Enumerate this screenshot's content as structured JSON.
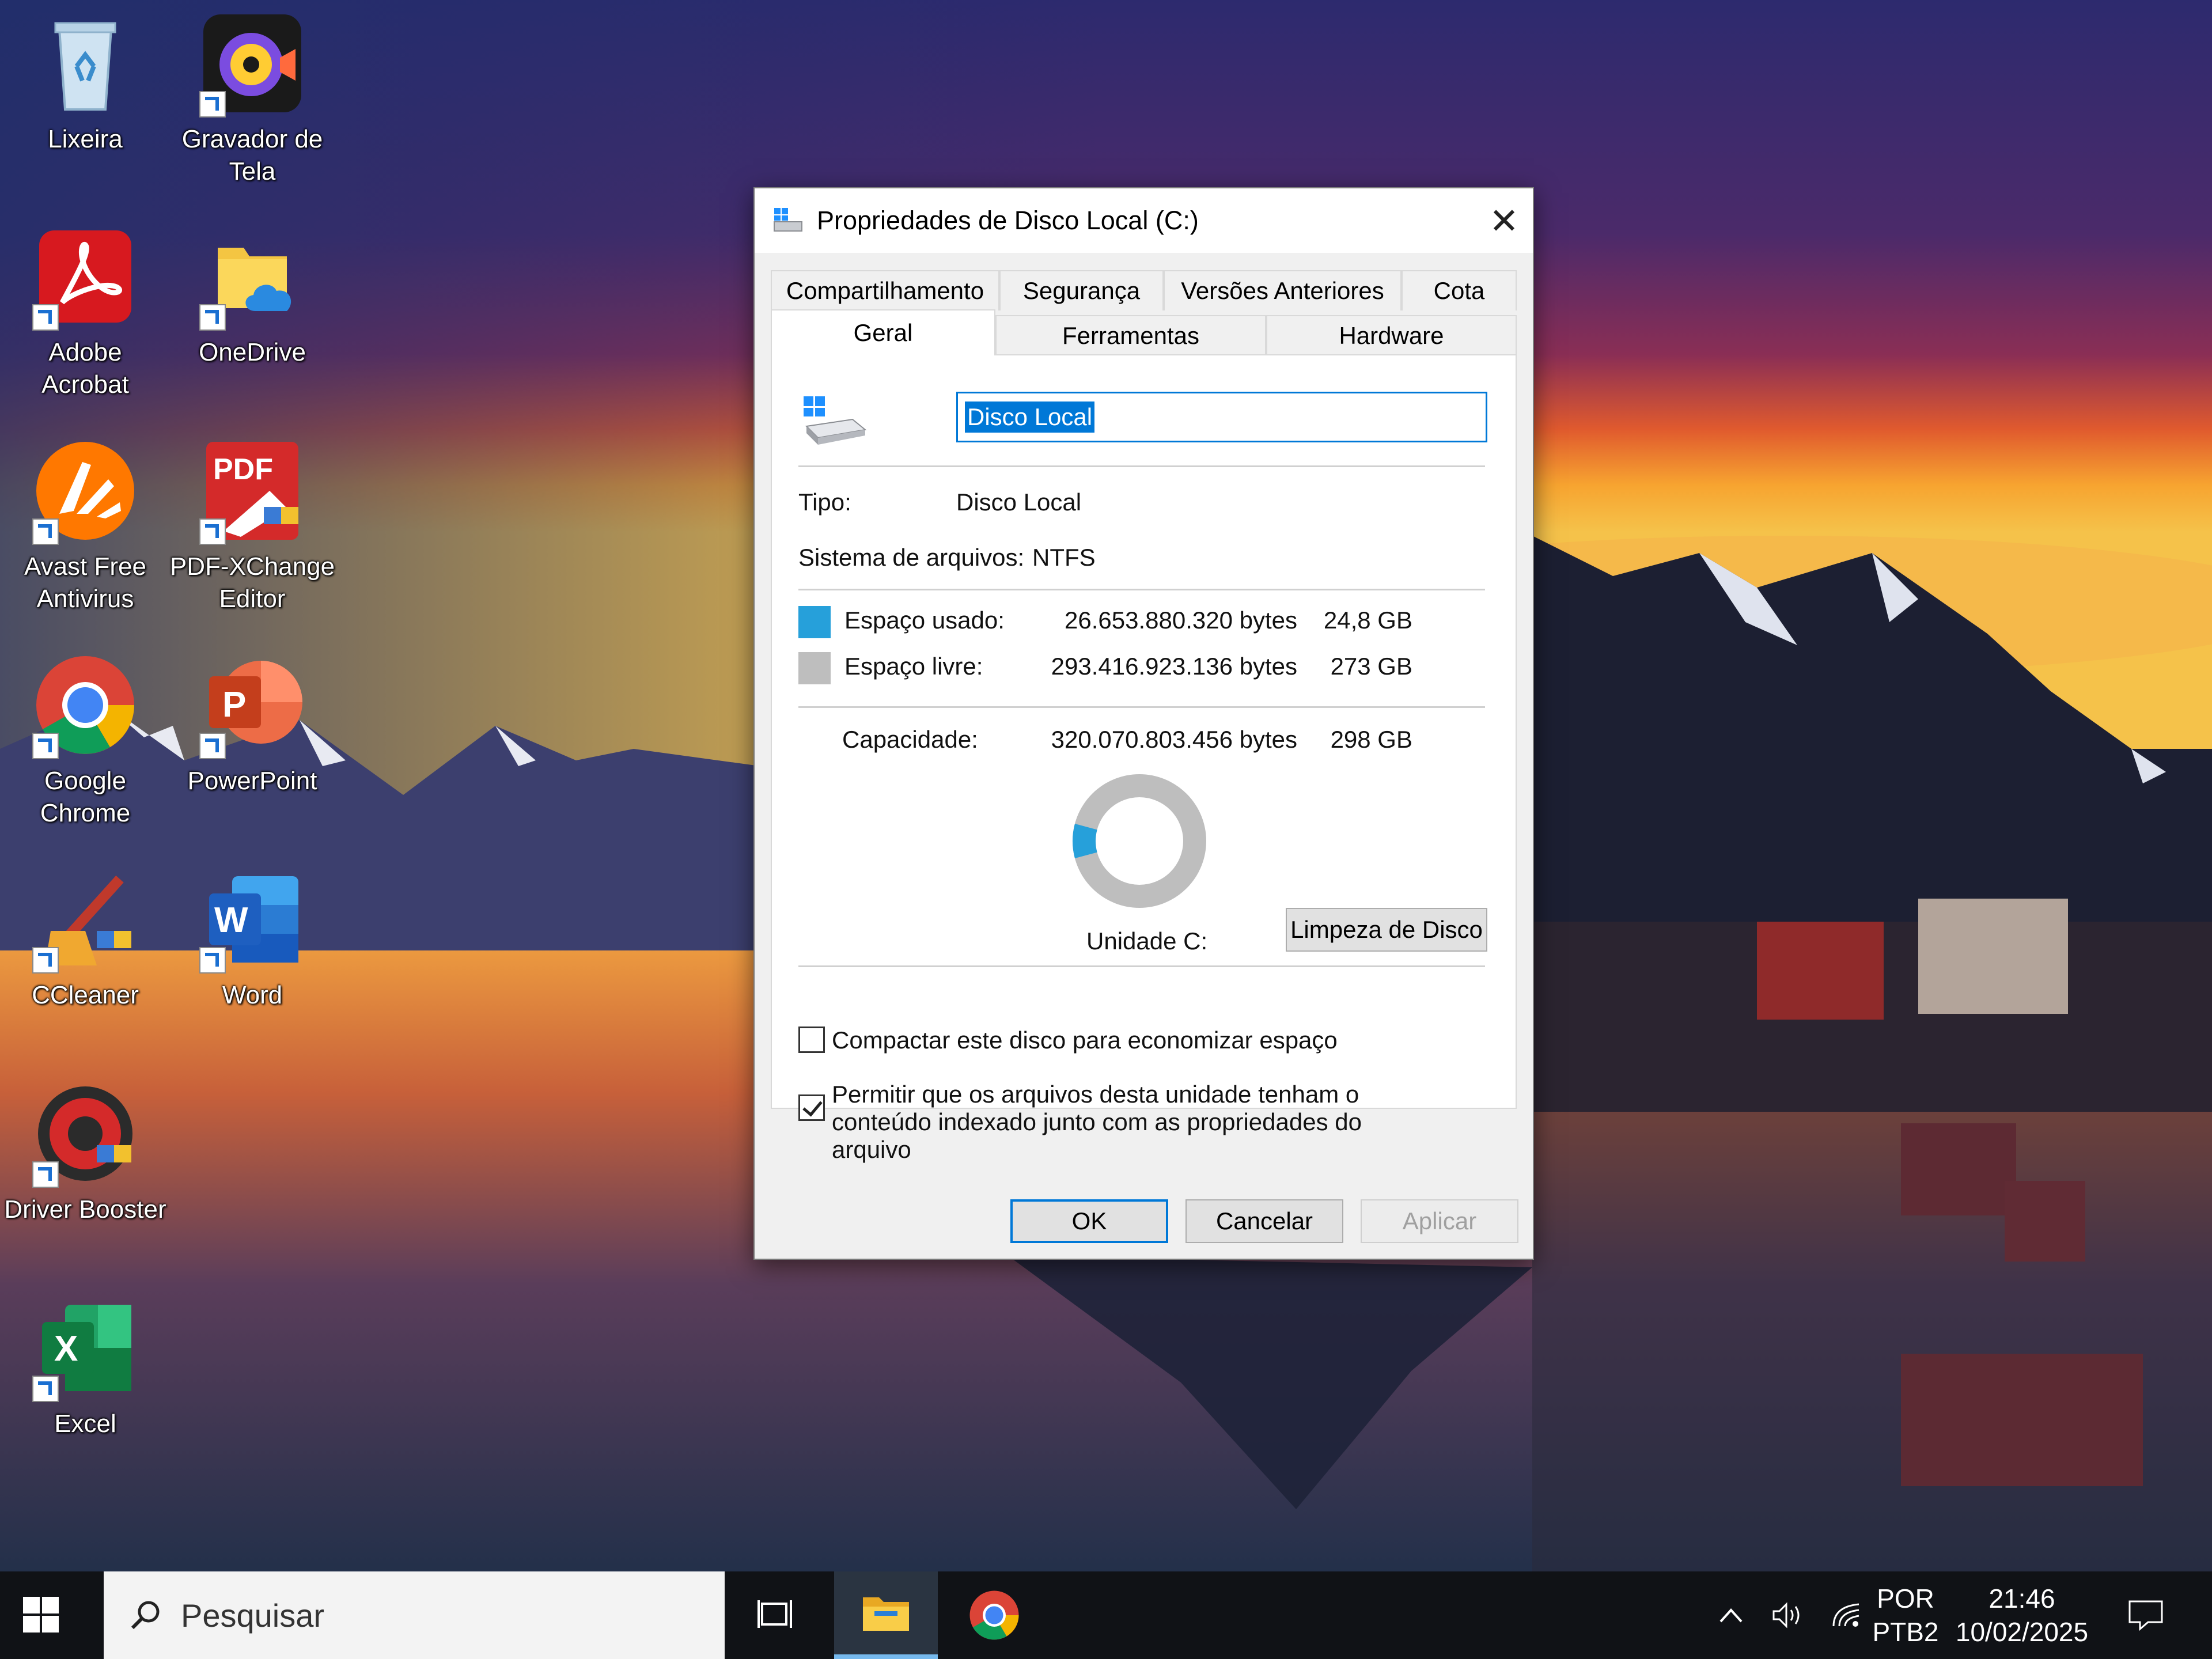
{
  "desktop": {
    "icons": [
      {
        "label": "Lixeira"
      },
      {
        "label": "Gravador de\nTela"
      },
      {
        "label": "Adobe\nAcrobat"
      },
      {
        "label": "OneDrive"
      },
      {
        "label": "Avast Free\nAntivirus"
      },
      {
        "label": "PDF-XChange\nEditor"
      },
      {
        "label": "Google\nChrome"
      },
      {
        "label": "PowerPoint"
      },
      {
        "label": "CCleaner"
      },
      {
        "label": "Word"
      },
      {
        "label": "Driver Booster"
      },
      {
        "label": "Excel"
      }
    ]
  },
  "dialog": {
    "title": "Propriedades de Disco Local (C:)",
    "close_glyph": "✕",
    "tabs_row1": [
      "Compartilhamento",
      "Segurança",
      "Versões Anteriores",
      "Cota"
    ],
    "tabs_row2": [
      "Geral",
      "Ferramentas",
      "Hardware"
    ],
    "active_tab": "Geral",
    "name_value": "Disco Local",
    "type_label": "Tipo:",
    "type_value": "Disco Local",
    "fs_label": "Sistema de arquivos:",
    "fs_value": "NTFS",
    "used_label": "Espaço usado:",
    "used_bytes": "26.653.880.320 bytes",
    "used_size": "24,8 GB",
    "free_label": "Espaço livre:",
    "free_bytes": "293.416.923.136 bytes",
    "free_size": "273 GB",
    "capacity_label": "Capacidade:",
    "capacity_bytes": "320.070.803.456 bytes",
    "capacity_size": "298 GB",
    "drive_label": "Unidade C:",
    "cleanup_button": "Limpeza de Disco",
    "compress_label": "Compactar este disco para economizar espaço",
    "compress_checked": false,
    "index_label": "Permitir que os arquivos desta unidade tenham o conteúdo indexado junto com as propriedades do arquivo",
    "index_checked": true,
    "ok_button": "OK",
    "cancel_button": "Cancelar",
    "apply_button": "Aplicar",
    "used_fraction": 0.0833,
    "colors": {
      "used": "#26a0da",
      "free": "#bebebe",
      "accent": "#0078d7"
    }
  },
  "taskbar": {
    "search_placeholder": "Pesquisar",
    "language_line1": "POR",
    "language_line2": "PTB2",
    "time": "21:46",
    "date": "10/02/2025",
    "icons": [
      "start-icon",
      "search-icon",
      "task-view-icon",
      "file-explorer-icon",
      "chrome-icon",
      "chevron-up-icon",
      "volume-icon",
      "network-icon",
      "notification-icon"
    ]
  }
}
